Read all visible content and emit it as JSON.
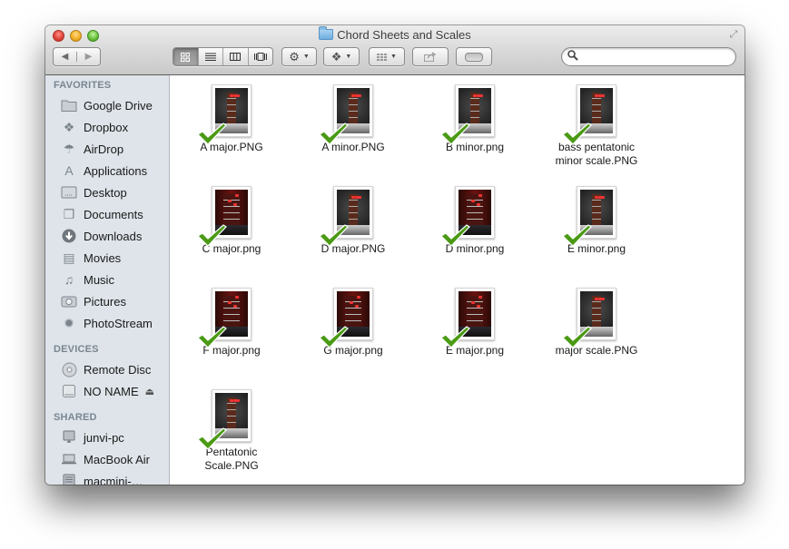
{
  "window": {
    "title": "Chord Sheets and Scales",
    "folder_icon": "folder-icon"
  },
  "toolbar": {
    "back_glyph": "◀",
    "forward_glyph": "▶",
    "views": [
      {
        "name": "icon-view",
        "glyph": "⊞",
        "active": true
      },
      {
        "name": "list-view",
        "glyph": "☰",
        "active": false
      },
      {
        "name": "column-view",
        "glyph": "▥",
        "active": false
      },
      {
        "name": "cover-flow-view",
        "glyph": "▯",
        "active": false
      }
    ],
    "action_glyph": "⚙",
    "dropbox_glyph": "❖",
    "arrange_glyph": "▦",
    "share_glyph": "⇪",
    "caret": "▼",
    "search": {
      "placeholder": "",
      "value": "",
      "icon": "⚲"
    }
  },
  "sidebar": {
    "favorites_header": "FAVORITES",
    "favorites": [
      {
        "label": "Google Drive",
        "icon": "folder-icon",
        "glyph": "▭"
      },
      {
        "label": "Dropbox",
        "icon": "dropbox-icon",
        "glyph": "❖"
      },
      {
        "label": "AirDrop",
        "icon": "airdrop-icon",
        "glyph": "☂"
      },
      {
        "label": "Applications",
        "icon": "applications-icon",
        "glyph": "A"
      },
      {
        "label": "Desktop",
        "icon": "desktop-icon",
        "glyph": "▭"
      },
      {
        "label": "Documents",
        "icon": "documents-icon",
        "glyph": "❐"
      },
      {
        "label": "Downloads",
        "icon": "downloads-icon",
        "glyph": "⬇"
      },
      {
        "label": "Movies",
        "icon": "movies-icon",
        "glyph": "▤"
      },
      {
        "label": "Music",
        "icon": "music-icon",
        "glyph": "♫"
      },
      {
        "label": "Pictures",
        "icon": "pictures-icon",
        "glyph": "◉"
      },
      {
        "label": "PhotoStream",
        "icon": "photostream-icon",
        "glyph": "✹"
      }
    ],
    "devices_header": "DEVICES",
    "devices": [
      {
        "label": "Remote Disc",
        "icon": "disc-icon",
        "glyph": "◎"
      },
      {
        "label": "NO NAME",
        "icon": "drive-icon",
        "glyph": "▭",
        "eject": "⏏"
      }
    ],
    "shared_header": "SHARED",
    "shared": [
      {
        "label": "junvi-pc",
        "icon": "pc-icon",
        "glyph": "▣"
      },
      {
        "label": "MacBook Air",
        "icon": "laptop-icon",
        "glyph": "▭"
      },
      {
        "label": "macmini-…",
        "icon": "macmini-icon",
        "glyph": "▣"
      }
    ]
  },
  "files": [
    {
      "name": "A major.PNG",
      "style": "gray",
      "synced": true
    },
    {
      "name": "A minor.PNG",
      "style": "gray",
      "synced": true
    },
    {
      "name": "B minor.png",
      "style": "gray",
      "synced": true
    },
    {
      "name": "bass pentatonic minor scale.PNG",
      "style": "gray",
      "synced": true
    },
    {
      "name": "C major.png",
      "style": "red",
      "synced": true
    },
    {
      "name": "D major.PNG",
      "style": "gray",
      "synced": true
    },
    {
      "name": "D minor.png",
      "style": "red",
      "synced": true
    },
    {
      "name": "E minor.png",
      "style": "gray",
      "synced": true
    },
    {
      "name": "F major.png",
      "style": "red",
      "synced": true
    },
    {
      "name": "G major.png",
      "style": "red",
      "synced": true
    },
    {
      "name": "E major.png",
      "style": "red",
      "synced": true
    },
    {
      "name": "major scale.PNG",
      "style": "gray",
      "synced": true
    },
    {
      "name": "Pentatonic Scale.PNG",
      "style": "gray",
      "synced": true
    }
  ]
}
